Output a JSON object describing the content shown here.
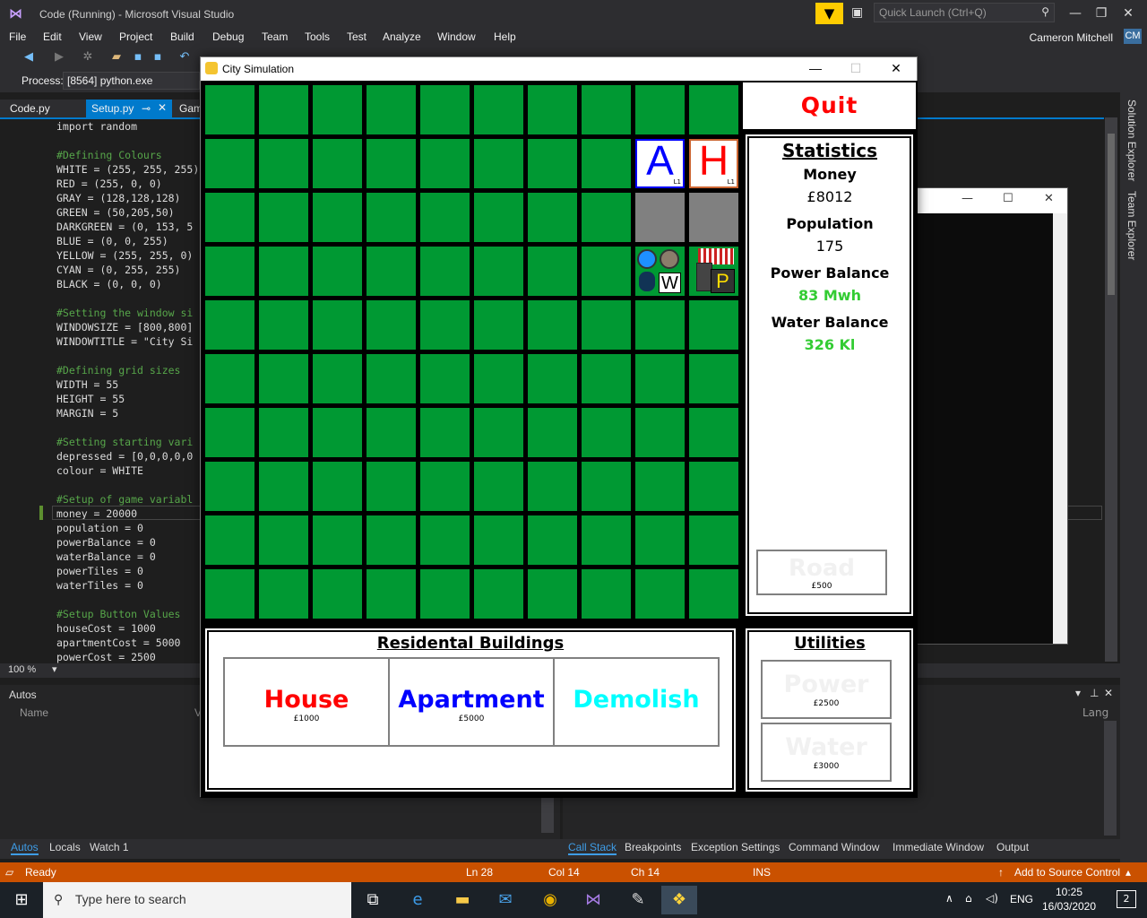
{
  "vs": {
    "title": "Code (Running) - Microsoft Visual Studio",
    "quick_launch_placeholder": "Quick Launch (Ctrl+Q)",
    "menu": [
      "File",
      "Edit",
      "View",
      "Project",
      "Build",
      "Debug",
      "Team",
      "Tools",
      "Test",
      "Analyze",
      "Window",
      "Help"
    ],
    "user_name": "Cameron Mitchell",
    "user_initials": "CM",
    "process_label": "Process:",
    "process_value": "[8564] python.exe",
    "tabs": [
      "Code.py",
      "Setup.py",
      "Gam"
    ],
    "code_lines": [
      {
        "t": "import random",
        "k": "c-normal"
      },
      {
        "t": "",
        "k": "c-normal"
      },
      {
        "t": "#Defining Colours",
        "k": "c-comment"
      },
      {
        "t": "WHITE = (255, 255, 255)",
        "k": "c-normal"
      },
      {
        "t": "RED = (255, 0, 0)",
        "k": "c-normal"
      },
      {
        "t": "GRAY = (128,128,128)",
        "k": "c-normal"
      },
      {
        "t": "GREEN = (50,205,50)",
        "k": "c-normal"
      },
      {
        "t": "DARKGREEN = (0, 153, 5",
        "k": "c-normal"
      },
      {
        "t": "BLUE = (0, 0, 255)",
        "k": "c-normal"
      },
      {
        "t": "YELLOW = (255, 255, 0)",
        "k": "c-normal"
      },
      {
        "t": "CYAN = (0, 255, 255)",
        "k": "c-normal"
      },
      {
        "t": "BLACK = (0, 0, 0)",
        "k": "c-normal"
      },
      {
        "t": "",
        "k": "c-normal"
      },
      {
        "t": "#Setting the window si",
        "k": "c-comment"
      },
      {
        "t": "WINDOWSIZE = [800,800]",
        "k": "c-normal"
      },
      {
        "t": "WINDOWTITLE = \"City Si",
        "k": "c-normal"
      },
      {
        "t": "",
        "k": "c-normal"
      },
      {
        "t": "#Defining grid sizes",
        "k": "c-comment"
      },
      {
        "t": "WIDTH = 55",
        "k": "c-normal"
      },
      {
        "t": "HEIGHT = 55",
        "k": "c-normal"
      },
      {
        "t": "MARGIN = 5",
        "k": "c-normal"
      },
      {
        "t": "",
        "k": "c-normal"
      },
      {
        "t": "#Setting starting vari",
        "k": "c-comment"
      },
      {
        "t": "depressed = [0,0,0,0,0",
        "k": "c-normal"
      },
      {
        "t": "colour = WHITE",
        "k": "c-normal"
      },
      {
        "t": "",
        "k": "c-normal"
      },
      {
        "t": "#Setup of game variabl",
        "k": "c-comment"
      },
      {
        "t": "money = 20000",
        "k": "c-normal"
      },
      {
        "t": "population = 0",
        "k": "c-normal"
      },
      {
        "t": "powerBalance = 0",
        "k": "c-normal"
      },
      {
        "t": "waterBalance = 0",
        "k": "c-normal"
      },
      {
        "t": "powerTiles = 0",
        "k": "c-normal"
      },
      {
        "t": "waterTiles = 0",
        "k": "c-normal"
      },
      {
        "t": "",
        "k": "c-normal"
      },
      {
        "t": "#Setup Button Values",
        "k": "c-comment"
      },
      {
        "t": "houseCost = 1000",
        "k": "c-normal"
      },
      {
        "t": "apartmentCost = 5000",
        "k": "c-normal"
      },
      {
        "t": "powerCost = 2500",
        "k": "c-normal"
      }
    ],
    "zoom": "100 %",
    "autos_title": "Autos",
    "autos_name_col": "Name",
    "autos_v_col": "V",
    "autos_lang_col": "Lang",
    "bottom_tabs_left": [
      "Autos",
      "Locals",
      "Watch 1"
    ],
    "bottom_tabs_right": [
      "Call Stack",
      "Breakpoints",
      "Exception Settings",
      "Command Window",
      "Immediate Window",
      "Output"
    ],
    "status": {
      "ready": "Ready",
      "ln": "Ln 28",
      "col": "Col 14",
      "ch": "Ch 14",
      "ins": "INS",
      "source_control": "Add to Source Control"
    },
    "side_tabs": [
      "Solution Explorer",
      "Team Explorer"
    ]
  },
  "taskbar": {
    "search_placeholder": "Type here to search",
    "lang": "ENG",
    "time": "10:25",
    "date": "16/03/2020",
    "notifications": "2"
  },
  "city": {
    "window_title": "City Simulation",
    "quit_label": "Quit",
    "stats_title": "Statistics",
    "money_label": "Money",
    "money_value": "£8012",
    "population_label": "Population",
    "population_value": "175",
    "power_label": "Power Balance",
    "power_value": "83 Mwh",
    "water_label": "Water Balance",
    "water_value": "326 Kl",
    "road_label": "Road",
    "road_cost": "£500",
    "res_title": "Residental Buildings",
    "house_label": "House",
    "house_cost": "£1000",
    "apartment_label": "Apartment",
    "apartment_cost": "£5000",
    "demolish_label": "Demolish",
    "util_title": "Utilities",
    "power_btn_label": "Power",
    "power_btn_cost": "£2500",
    "water_btn_label": "Water",
    "water_btn_cost": "£3000",
    "apartment_tile_letter": "A",
    "house_tile_letter": "H",
    "tile_level": "L1",
    "water_tile_letter": "W",
    "power_tile_letter": "P",
    "colors": {
      "grass": "#009933",
      "road": "#808080",
      "red": "#ff0000",
      "blue": "#0000ff",
      "cyan": "#00ffff",
      "green_text": "#33cc33"
    }
  }
}
